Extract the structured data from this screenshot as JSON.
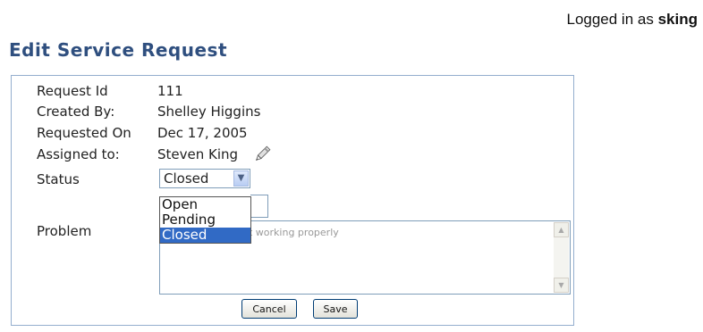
{
  "header": {
    "login_prefix": "Logged in as",
    "username": "sking"
  },
  "page_title": "Edit Service Request",
  "form": {
    "fields": {
      "request_id": {
        "label": "Request Id",
        "value": "111"
      },
      "created_by": {
        "label": "Created By:",
        "value": "Shelley Higgins"
      },
      "requested_on": {
        "label": "Requested On",
        "value": "Dec 17, 2005"
      },
      "assigned_to": {
        "label": "Assigned to:",
        "value": "Steven King"
      },
      "status": {
        "label": "Status",
        "value": "Closed"
      },
      "problem": {
        "label": "Problem",
        "value": "t working properly"
      }
    },
    "status_options": [
      "Open",
      "Pending",
      "Closed"
    ],
    "selected_status_option": "Closed",
    "buttons": {
      "cancel": "Cancel",
      "save": "Save"
    }
  },
  "icons": {
    "assign": "pencil-icon",
    "dropdown": "chevron-down-icon",
    "scroll_up": "scroll-up-arrow-icon",
    "scroll_down": "scroll-down-arrow-icon"
  },
  "colors": {
    "title": "#2f4f7f",
    "panel_border": "#94aece",
    "selection": "#316ac5"
  }
}
